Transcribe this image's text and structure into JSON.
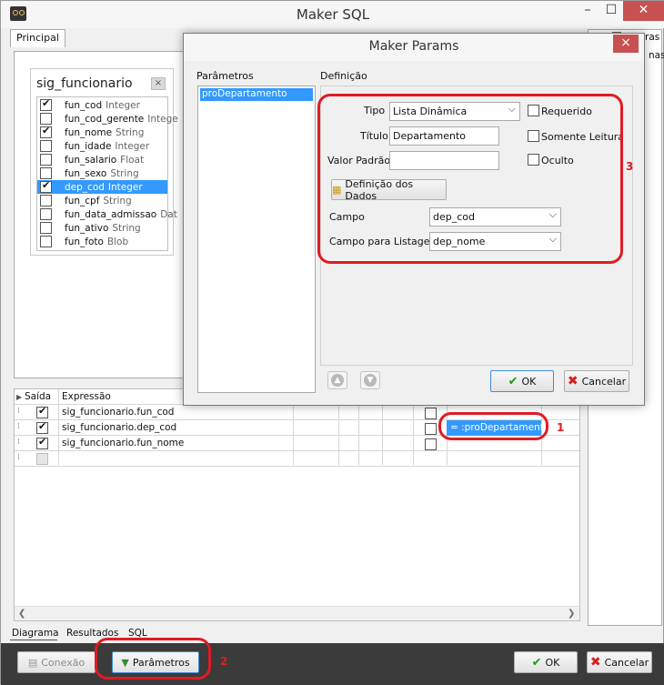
{
  "main_window": {
    "title": "Maker SQL",
    "tab_principal": "Principal",
    "right_panel_items": [
      "ras",
      "nas"
    ]
  },
  "table_box": {
    "title": "sig_funcionario",
    "close": "×",
    "fields": [
      {
        "name": "fun_cod",
        "type": "Integer",
        "checked": true,
        "selected": false
      },
      {
        "name": "fun_cod_gerente",
        "type": "Intege",
        "checked": false,
        "selected": false
      },
      {
        "name": "fun_nome",
        "type": "String",
        "checked": true,
        "selected": false
      },
      {
        "name": "fun_idade",
        "type": "Integer",
        "checked": false,
        "selected": false
      },
      {
        "name": "fun_salario",
        "type": "Float",
        "checked": false,
        "selected": false
      },
      {
        "name": "fun_sexo",
        "type": "String",
        "checked": false,
        "selected": false
      },
      {
        "name": "dep_cod",
        "type": "Integer",
        "checked": true,
        "selected": true
      },
      {
        "name": "fun_cpf",
        "type": "String",
        "checked": false,
        "selected": false
      },
      {
        "name": "fun_data_admissao",
        "type": "Dat",
        "checked": false,
        "selected": false
      },
      {
        "name": "fun_ativo",
        "type": "String",
        "checked": false,
        "selected": false
      },
      {
        "name": "fun_foto",
        "type": "Blob",
        "checked": false,
        "selected": false
      }
    ]
  },
  "grid": {
    "col_saida": "Saída",
    "col_expressao": "Expressão",
    "rows": [
      {
        "expr": "sig_funcionario.fun_cod",
        "checked": true
      },
      {
        "expr": "sig_funcionario.dep_cod",
        "checked": true
      },
      {
        "expr": "sig_funcionario.fun_nome",
        "checked": true
      },
      {
        "expr": "",
        "checked": false
      }
    ],
    "criteria": "= :proDepartamento"
  },
  "bottom_tabs": [
    "Diagrama",
    "Resultados",
    "SQL"
  ],
  "bottom_bar": {
    "conexao": "Conexão",
    "parametros": "Parâmetros",
    "ok": "OK",
    "cancelar": "Cancelar"
  },
  "dialog": {
    "title": "Maker Params",
    "close": "×",
    "parametros_label": "Parâmetros",
    "definicao_label": "Definição",
    "param_items": [
      "proDepartamento"
    ],
    "tipo_label": "Tipo",
    "tipo_value": "Lista Dinâmica",
    "titulo_label": "Título",
    "titulo_value": "Departamento",
    "valor_padrao_label": "Valor Padrão",
    "valor_padrao_value": "",
    "requerido_label": "Requerido",
    "somente_leitura_label": "Somente Leitura",
    "oculto_label": "Oculto",
    "definicao_dados_button": "Definição dos Dados",
    "campo_label": "Campo",
    "campo_value": "dep_cod",
    "campo_listagem_label": "Campo para Listagem",
    "campo_listagem_value": "dep_nome",
    "ok": "OK",
    "cancelar": "Cancelar"
  },
  "annotations": {
    "n1": "1",
    "n2": "2",
    "n3": "3"
  },
  "colors": {
    "accent_red": "#e01b24",
    "selection_blue": "#3399ff",
    "ok_green": "#1a9c1a"
  }
}
